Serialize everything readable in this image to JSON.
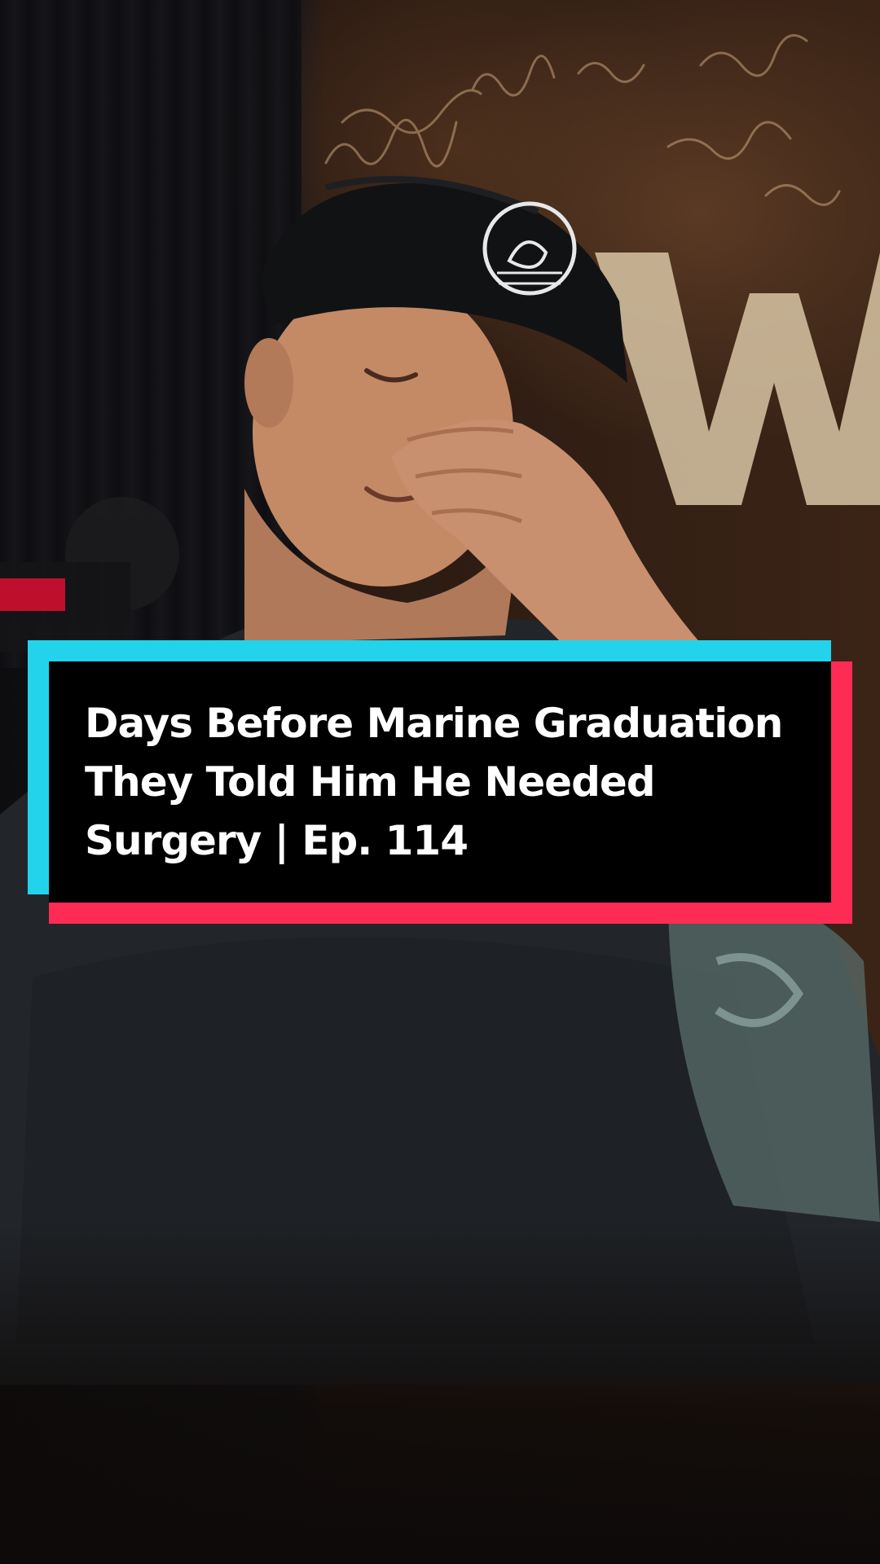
{
  "video": {
    "title_lines": [
      "Days Before Marine Graduation",
      "They Told Him He Needed",
      "Surgery | Ep. 114"
    ]
  },
  "colors": {
    "card_background": "#000000",
    "card_accent_cyan": "#23d3ec",
    "card_accent_red": "#fe2c55",
    "title_text": "#ffffff"
  }
}
